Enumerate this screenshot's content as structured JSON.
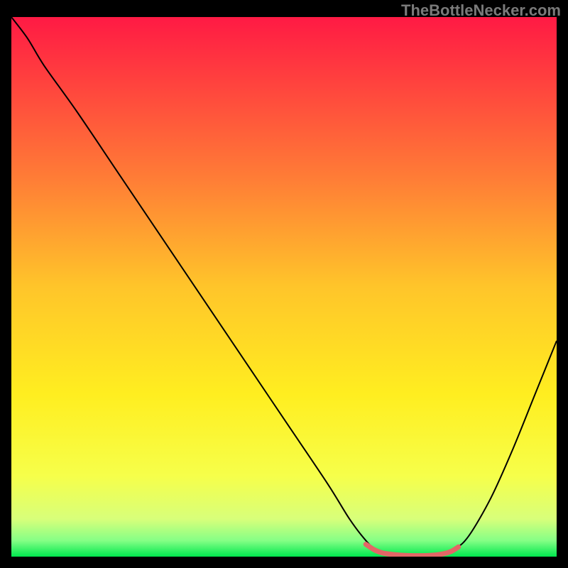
{
  "watermark": "TheBottleNecker.com",
  "chart_data": {
    "type": "line",
    "title": "",
    "xlabel": "",
    "ylabel": "",
    "xlim": [
      0,
      100
    ],
    "ylim": [
      0,
      100
    ],
    "gradient_stops": [
      {
        "offset": 0.0,
        "color": "#ff1a44"
      },
      {
        "offset": 0.1,
        "color": "#ff3b3f"
      },
      {
        "offset": 0.3,
        "color": "#ff7d36"
      },
      {
        "offset": 0.5,
        "color": "#ffc52a"
      },
      {
        "offset": 0.7,
        "color": "#ffee20"
      },
      {
        "offset": 0.85,
        "color": "#f6ff4a"
      },
      {
        "offset": 0.93,
        "color": "#d8ff7a"
      },
      {
        "offset": 0.97,
        "color": "#86ff86"
      },
      {
        "offset": 1.0,
        "color": "#00e84e"
      }
    ],
    "series": [
      {
        "name": "curve",
        "color": "#000000",
        "width": 2,
        "points": [
          {
            "x": 0.0,
            "y": 100.0
          },
          {
            "x": 3.0,
            "y": 96.0
          },
          {
            "x": 6.0,
            "y": 91.0
          },
          {
            "x": 12.0,
            "y": 82.5
          },
          {
            "x": 20.0,
            "y": 70.5
          },
          {
            "x": 30.0,
            "y": 55.5
          },
          {
            "x": 40.0,
            "y": 40.5
          },
          {
            "x": 50.0,
            "y": 25.5
          },
          {
            "x": 58.0,
            "y": 13.5
          },
          {
            "x": 62.0,
            "y": 7.0
          },
          {
            "x": 65.0,
            "y": 3.0
          },
          {
            "x": 67.0,
            "y": 1.2
          },
          {
            "x": 70.0,
            "y": 0.4
          },
          {
            "x": 75.0,
            "y": 0.2
          },
          {
            "x": 79.0,
            "y": 0.5
          },
          {
            "x": 81.5,
            "y": 1.5
          },
          {
            "x": 84.0,
            "y": 4.0
          },
          {
            "x": 88.0,
            "y": 11.0
          },
          {
            "x": 92.0,
            "y": 20.0
          },
          {
            "x": 96.0,
            "y": 30.0
          },
          {
            "x": 100.0,
            "y": 40.0
          }
        ]
      },
      {
        "name": "trough-marker",
        "color": "#e36666",
        "width": 7,
        "points": [
          {
            "x": 65.0,
            "y": 2.3
          },
          {
            "x": 66.5,
            "y": 1.3
          },
          {
            "x": 68.0,
            "y": 0.7
          },
          {
            "x": 70.0,
            "y": 0.4
          },
          {
            "x": 73.0,
            "y": 0.2
          },
          {
            "x": 76.0,
            "y": 0.2
          },
          {
            "x": 78.5,
            "y": 0.4
          },
          {
            "x": 80.5,
            "y": 0.9
          },
          {
            "x": 82.0,
            "y": 1.8
          }
        ]
      }
    ]
  }
}
